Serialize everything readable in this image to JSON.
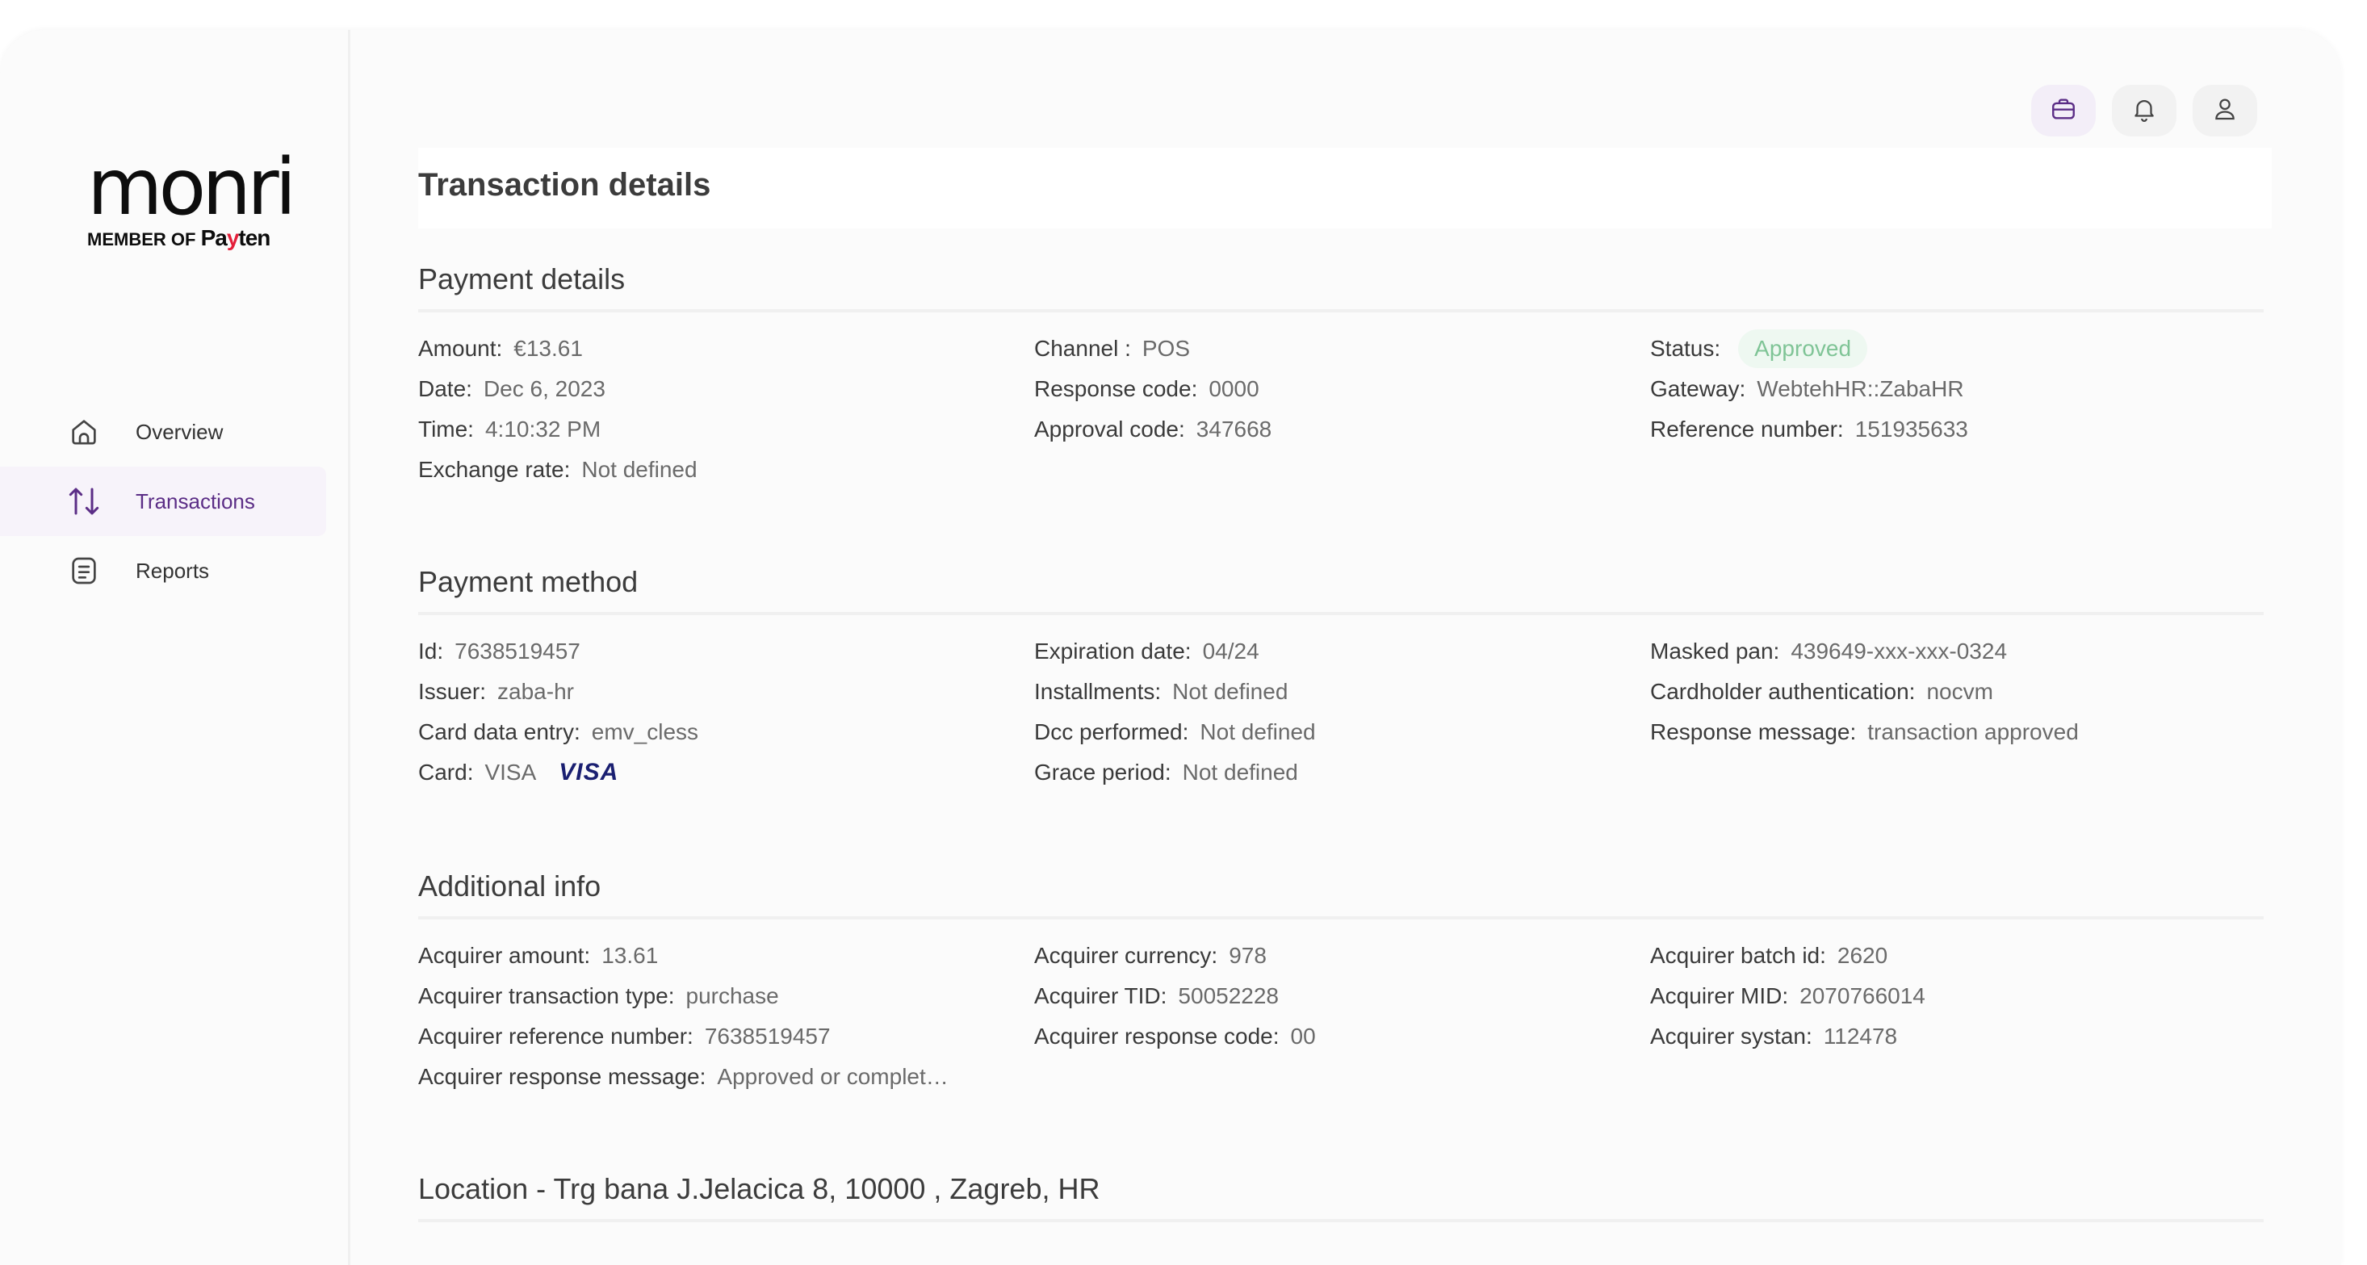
{
  "brand": {
    "logo_word": "monri",
    "logo_sub_prefix": "MEMBER OF ",
    "logo_sub_pa": "Pa",
    "logo_sub_y": "y",
    "logo_sub_ten": "ten"
  },
  "sidebar": {
    "items": [
      {
        "label": "Overview",
        "icon": "home-icon"
      },
      {
        "label": "Transactions",
        "icon": "transactions-icon",
        "active": true
      },
      {
        "label": "Reports",
        "icon": "reports-icon"
      }
    ]
  },
  "header": {
    "icons": [
      "briefcase-icon",
      "bell-icon",
      "user-icon"
    ]
  },
  "page": {
    "title": "Transaction details"
  },
  "payment_details": {
    "title": "Payment details",
    "amount_k": "Amount:",
    "amount_v": "€13.61",
    "date_k": "Date:",
    "date_v": "Dec 6, 2023",
    "time_k": "Time:",
    "time_v": "4:10:32 PM",
    "exchange_k": "Exchange rate:",
    "exchange_v": "Not defined",
    "channel_k": "Channel :",
    "channel_v": "POS",
    "response_code_k": "Response code:",
    "response_code_v": "0000",
    "approval_k": "Approval code:",
    "approval_v": "347668",
    "status_k": "Status:",
    "status_v": "Approved",
    "gateway_k": "Gateway:",
    "gateway_v": "WebtehHR::ZabaHR",
    "reference_k": "Reference number:",
    "reference_v": "151935633"
  },
  "payment_method": {
    "title": "Payment method",
    "id_k": "Id:",
    "id_v": "7638519457",
    "issuer_k": "Issuer:",
    "issuer_v": "zaba-hr",
    "entry_k": "Card data entry:",
    "entry_v": "emv_cless",
    "card_k": "Card:",
    "card_v": "VISA",
    "card_logo": "VISA",
    "expiration_k": "Expiration date:",
    "expiration_v": "04/24",
    "installments_k": "Installments:",
    "installments_v": "Not defined",
    "dcc_k": "Dcc performed:",
    "dcc_v": "Not defined",
    "grace_k": "Grace period:",
    "grace_v": "Not defined",
    "pan_k": "Masked pan:",
    "pan_v": "439649-xxx-xxx-0324",
    "auth_k": "Cardholder authentication:",
    "auth_v": "nocvm",
    "resp_msg_k": "Response message:",
    "resp_msg_v": "transaction approved"
  },
  "additional_info": {
    "title": "Additional info",
    "acq_amount_k": "Acquirer amount:",
    "acq_amount_v": "13.61",
    "acq_type_k": "Acquirer transaction type:",
    "acq_type_v": "purchase",
    "acq_ref_k": "Acquirer reference number:",
    "acq_ref_v": "7638519457",
    "acq_msg_k": "Acquirer response message:",
    "acq_msg_v": "Approved or complet…",
    "acq_currency_k": "Acquirer currency:",
    "acq_currency_v": "978",
    "acq_tid_k": "Acquirer TID:",
    "acq_tid_v": "50052228",
    "acq_resp_code_k": "Acquirer response code:",
    "acq_resp_code_v": "00",
    "acq_batch_k": "Acquirer batch id:",
    "acq_batch_v": "2620",
    "acq_mid_k": "Acquirer MID:",
    "acq_mid_v": "2070766014",
    "acq_systan_k": "Acquirer systan:",
    "acq_systan_v": "112478"
  },
  "location": {
    "title": "Location - Trg bana J.Jelacica 8, 10000 , Zagreb, HR"
  },
  "colors": {
    "accent": "#5b2d86",
    "approved_bg": "#eef8f1",
    "approved_text": "#7fc496",
    "visa": "#1a1f71"
  }
}
